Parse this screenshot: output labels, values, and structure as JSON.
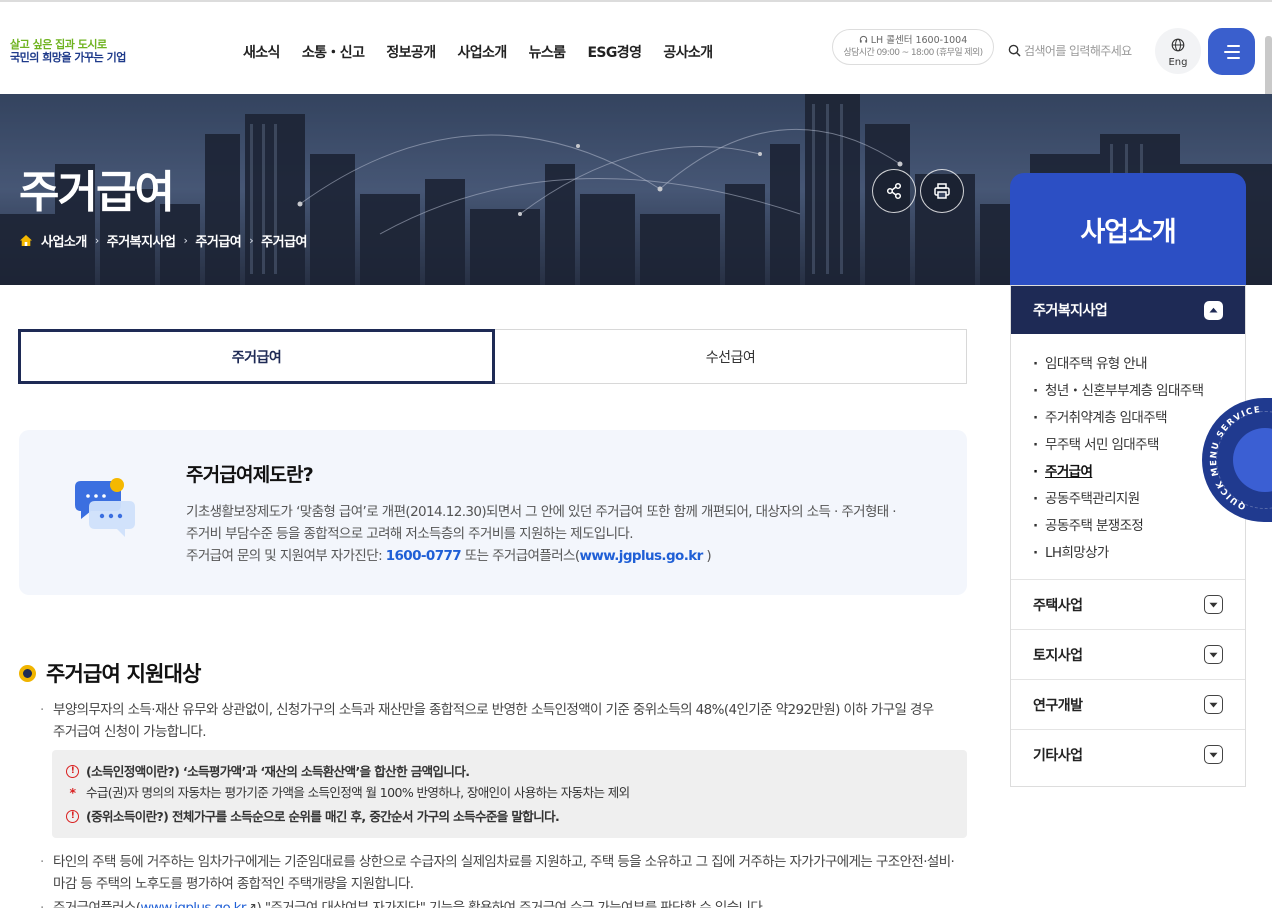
{
  "header": {
    "logo_line1": "살고 싶은 집과 도시로",
    "logo_line2": "국민의 희망을 가꾸는 기업",
    "nav": [
      "새소식",
      "소통・신고",
      "정보공개",
      "사업소개",
      "뉴스룸",
      "ESG경영",
      "공사소개"
    ],
    "callcenter_line1": "LH 콜센터 1600-1004",
    "callcenter_line2": "상담시간 09:00 ~ 18:00 (휴무일 제외)",
    "search_placeholder": "검색어를 입력해주세요",
    "lang_label": "Eng"
  },
  "hero": {
    "title": "주거급여",
    "breadcrumb": [
      "사업소개",
      "주거복지사업",
      "주거급여",
      "주거급여"
    ]
  },
  "side_nav": {
    "title": "사업소개",
    "active_group": "주거복지사업",
    "sub_items": [
      "임대주택 유형 안내",
      "청년・신혼부부계층 임대주택",
      "주거취약계층 임대주택",
      "무주택 서민 임대주택",
      "주거급여",
      "공동주택관리지원",
      "공동주택 분쟁조정",
      "LH희망상가"
    ],
    "current_sub_index": 4,
    "groups": [
      "주택사업",
      "토지사업",
      "연구개발",
      "기타사업"
    ],
    "quick_text": "QUICK MENU SERVICE"
  },
  "tabs": [
    "주거급여",
    "수선급여"
  ],
  "info": {
    "title": "주거급여제도란?",
    "line1": "기초생활보장제도가 ‘맞춤형 급여’로 개편(2014.12.30)되면서 그 안에 있던 주거급여 또한 함께 개편되어, 대상자의 소득 · 주거형태 ·",
    "line2": "주거비 부담수준 등을 종합적으로 고려해 저소득층의 주거비를 지원하는 제도입니다.",
    "line3_pre": "주거급여 문의 및 지원여부 자가진단: ",
    "phone": "1600-0777",
    "line3_mid": " 또는 주거급여플러스(",
    "url": "www.jgplus.go.kr",
    "line3_post": " )"
  },
  "section": {
    "title": "주거급여 지원대상",
    "para1_line1": "부양의무자의 소득·재산 유무와 상관없이, 신청가구의 소득과 재산만을 종합적으로 반영한 소득인정액이 기준 중위소득의 48%(4인기준 약292만원) 이하 가구일 경우",
    "para1_line2": "주거급여 신청이 가능합니다.",
    "notes": [
      "(소득인정액이란?) ‘소득평가액’과 ‘재산의 소득환산액’을 합산한 금액입니다.",
      "수급(권)자 명의의 자동차는 평가기준 가액을 소득인정액 월 100% 반영하나, 장애인이 사용하는 자동차는 제외",
      "(중위소득이란?) 전체가구를 소득순으로 순위를 매긴 후, 중간순서 가구의 소득수준을 말합니다."
    ],
    "para2_line1": "타인의 주택 등에 거주하는 임차가구에게는 기준임대료를 상한으로 수급자의 실제임차료를 지원하고, 주택 등을 소유하고 그 집에 거주하는 자가가구에게는 구조안전·설비·",
    "para2_line2": "마감 등 주택의 노후도를 평가하여 종합적인 주택개량을 지원합니다.",
    "para3_pre": "주거급여플러스(",
    "para3_link": "www.jgplus.go.kr",
    "para3_post": ") \"주거급여 대상여부 자가진단\" 기능을 활용하여 주거급여 수급 가능여부를 판단할 수 있습니다."
  },
  "colors": {
    "primary": "#2c4fc4",
    "navy": "#1e2a55",
    "accent_yellow": "#f0b400",
    "link_blue": "#1f5fd6",
    "alert_red": "#d92020"
  }
}
